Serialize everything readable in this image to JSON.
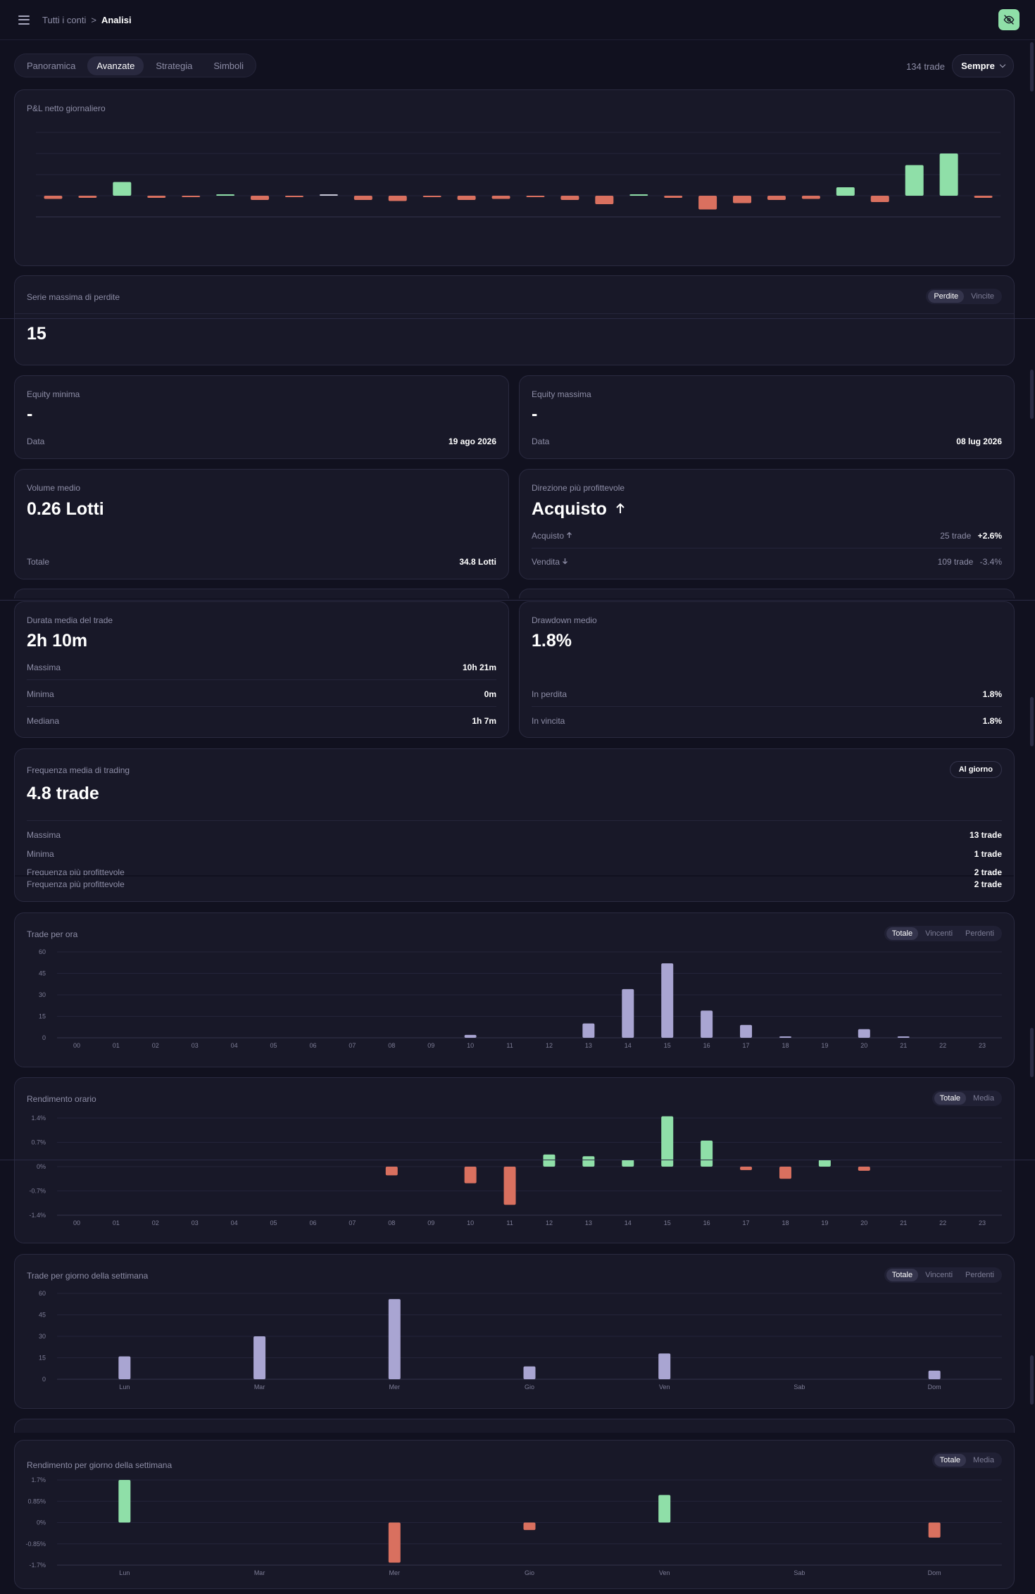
{
  "header": {
    "breadcrumb_root": "Tutti i conti",
    "breadcrumb_sep": ">",
    "breadcrumb_current": "Analisi"
  },
  "tabs": [
    {
      "label": "Panoramica",
      "active": false
    },
    {
      "label": "Avanzate",
      "active": true
    },
    {
      "label": "Strategia",
      "active": false
    },
    {
      "label": "Simboli",
      "active": false
    }
  ],
  "toolbar": {
    "trade_count": "134 trade",
    "range": "Sempre"
  },
  "colors": {
    "green": "#8fdfa8",
    "red": "#d9705f",
    "purple": "#a9a5d2",
    "accent": "#8fdfa8"
  },
  "icons": {
    "menu": "hamburger-icon",
    "hide": "eye-off-icon",
    "chevron": "chevron-down-icon",
    "up": "arrow-up-icon",
    "down": "arrow-down-icon"
  },
  "pnl_card": {
    "title": "P&L netto giornaliero"
  },
  "streak": {
    "title": "Serie massima di perdite",
    "toggle": [
      {
        "label": "Perdite",
        "active": true
      },
      {
        "label": "Vincite",
        "active": false
      }
    ],
    "value": "15"
  },
  "equity_min": {
    "title": "Equity minima",
    "value": "-",
    "date_label": "Data",
    "date_value": "19 ago 2026"
  },
  "equity_max": {
    "title": "Equity massima",
    "value": "-",
    "date_label": "Data",
    "date_value": "08 lug 2026"
  },
  "volume": {
    "title": "Volume medio",
    "value": "0.26 Lotti",
    "total_label": "Totale",
    "total_value": "34.8 Lotti"
  },
  "direction": {
    "title": "Direzione più profittevole",
    "value": "Acquisto",
    "buy_label": "Acquisto",
    "buy_trades": "25 trade",
    "buy_pct": "+2.6%",
    "sell_label": "Vendita",
    "sell_trades": "109 trade",
    "sell_pct": "-3.4%"
  },
  "duration": {
    "title": "Durata media del trade",
    "value": "2h 10m",
    "max_label": "Massima",
    "max_value": "10h 21m",
    "min_label": "Minima",
    "min_value": "0m",
    "median_label": "Mediana",
    "median_value": "1h 7m"
  },
  "drawdown": {
    "title": "Drawdown medio",
    "value": "1.8%",
    "loss_label": "In perdita",
    "loss_value": "1.8%",
    "win_label": "In vincita",
    "win_value": "1.8%"
  },
  "frequency": {
    "title": "Frequenza media di trading",
    "badge": "Al giorno",
    "value": "4.8 trade",
    "max_label": "Massima",
    "max_value": "13 trade",
    "min_label": "Minima",
    "min_value": "1 trade",
    "fav_label": "Frequenza più profittevole",
    "fav_value": "2 trade"
  },
  "hour_trades_card": {
    "title": "Trade per ora",
    "toggle": [
      {
        "label": "Totale",
        "active": true
      },
      {
        "label": "Vincenti",
        "active": false
      },
      {
        "label": "Perdenti",
        "active": false
      }
    ]
  },
  "hour_perf_card": {
    "title": "Rendimento orario",
    "toggle": [
      {
        "label": "Totale",
        "active": true
      },
      {
        "label": "Media",
        "active": false
      }
    ]
  },
  "day_trades_card": {
    "title": "Trade per giorno della settimana",
    "toggle": [
      {
        "label": "Totale",
        "active": true
      },
      {
        "label": "Vincenti",
        "active": false
      },
      {
        "label": "Perdenti",
        "active": false
      }
    ]
  },
  "day_perf_card": {
    "title": "Rendimento per giorno della settimana",
    "toggle": [
      {
        "label": "Totale",
        "active": true
      },
      {
        "label": "Media",
        "active": false
      }
    ]
  },
  "chart_data": [
    {
      "id": "daily_pnl",
      "type": "bar",
      "title": "P&L netto giornaliero",
      "values": [
        -0.3,
        -0.2,
        1.3,
        -0.2,
        -0.1,
        0.1,
        -0.4,
        -0.1,
        0,
        -0.4,
        -0.5,
        -0.1,
        -0.4,
        -0.3,
        -0.1,
        -0.4,
        -0.8,
        0.1,
        -0.2,
        -1.3,
        -0.7,
        -0.4,
        -0.3,
        0.8,
        -0.6,
        2.9,
        4.0,
        -0.2
      ],
      "ylim": [
        -2,
        6
      ]
    },
    {
      "id": "trades_per_hour",
      "type": "bar",
      "title": "Trade per ora",
      "categories": [
        "00",
        "01",
        "02",
        "03",
        "04",
        "05",
        "06",
        "07",
        "08",
        "09",
        "10",
        "11",
        "12",
        "13",
        "14",
        "15",
        "16",
        "17",
        "18",
        "19",
        "20",
        "21",
        "22",
        "23"
      ],
      "values": [
        0,
        0,
        0,
        0,
        0,
        0,
        0,
        0,
        0,
        0,
        2,
        0,
        0,
        10,
        34,
        52,
        19,
        9,
        1,
        0,
        6,
        1,
        0,
        0
      ],
      "ylim": [
        0,
        60
      ],
      "yticks": [
        "60",
        "45",
        "30",
        "15",
        "0"
      ]
    },
    {
      "id": "hourly_performance",
      "type": "bar",
      "title": "Rendimento orario",
      "categories": [
        "00",
        "01",
        "02",
        "03",
        "04",
        "05",
        "06",
        "07",
        "08",
        "09",
        "10",
        "11",
        "12",
        "13",
        "14",
        "15",
        "16",
        "17",
        "18",
        "19",
        "20",
        "21",
        "22",
        "23"
      ],
      "values": [
        0,
        0,
        0,
        0,
        0,
        0,
        0,
        0,
        -0.25,
        0,
        -0.48,
        -1.1,
        0.35,
        0.3,
        0.2,
        1.45,
        0.75,
        -0.1,
        -0.35,
        0.2,
        -0.12,
        0,
        0,
        0
      ],
      "ylim": [
        -1.4,
        1.4
      ],
      "yticks": [
        "1.4%",
        "0.7%",
        "0%",
        "-0.7%",
        "-1.4%"
      ]
    },
    {
      "id": "trades_per_weekday",
      "type": "bar",
      "title": "Trade per giorno della settimana",
      "categories": [
        "Lun",
        "Mar",
        "Mer",
        "Gio",
        "Ven",
        "Sab",
        "Dom"
      ],
      "values": [
        16,
        30,
        56,
        9,
        18,
        0,
        6
      ],
      "ylim": [
        0,
        60
      ],
      "yticks": [
        "60",
        "45",
        "30",
        "15",
        "0"
      ]
    },
    {
      "id": "weekday_performance",
      "type": "bar",
      "title": "Rendimento per giorno della settimana",
      "categories": [
        "Lun",
        "Mar",
        "Mer",
        "Gio",
        "Ven",
        "Sab",
        "Dom"
      ],
      "values": [
        1.7,
        0,
        -1.6,
        -0.3,
        1.1,
        0,
        -0.6
      ],
      "ylim": [
        -1.7,
        1.7
      ],
      "yticks": [
        "1.7%",
        "0.85%",
        "0%",
        "-0.85%",
        "-1.7%"
      ]
    }
  ]
}
